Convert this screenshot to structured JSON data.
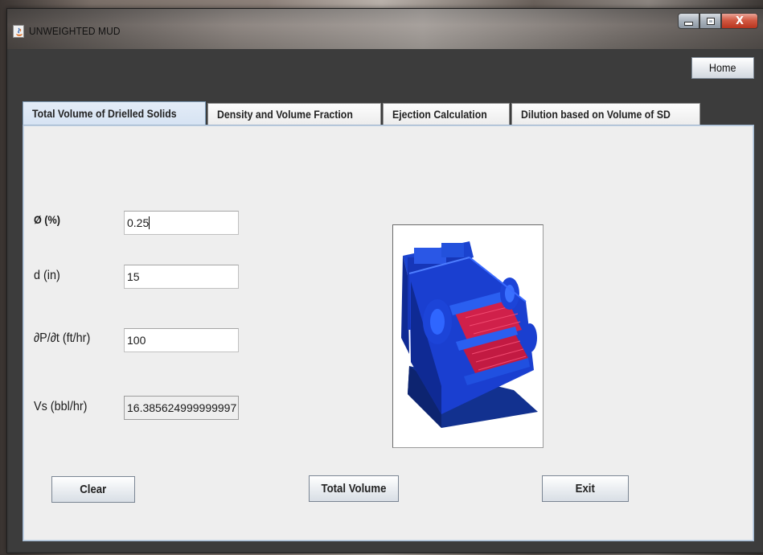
{
  "window": {
    "title": "UNWEIGHTED MUD",
    "controls": {
      "minimize": "minimize",
      "maximize": "maximize",
      "close": "X"
    }
  },
  "header": {
    "home_label": "Home"
  },
  "tabs": [
    {
      "label": "Total Volume of Drielled Solids",
      "active": true
    },
    {
      "label": "Density and Volume Fraction",
      "active": false
    },
    {
      "label": "Ejection Calculation",
      "active": false
    },
    {
      "label": "Dilution based on Volume of SD",
      "active": false
    }
  ],
  "form": {
    "phi": {
      "label": "Ø (%)",
      "value": "0.25"
    },
    "d": {
      "label": "d (in)",
      "value": "15"
    },
    "dpdt": {
      "label": "∂P/∂t (ft/hr)",
      "value": "100"
    },
    "vs": {
      "label": "Vs (bbl/hr)",
      "value": "16.385624999999997"
    }
  },
  "buttons": {
    "clear": "Clear",
    "total_volume": "Total Volume",
    "exit": "Exit"
  },
  "image": {
    "subject": "shale-shaker-illustration"
  },
  "colors": {
    "window_bg": "#3c3c3c",
    "panel_bg": "#eeeeee",
    "active_tab": "#d6e3f3",
    "machine_blue": "#1a3fd0",
    "screen_red": "#d0204a"
  }
}
